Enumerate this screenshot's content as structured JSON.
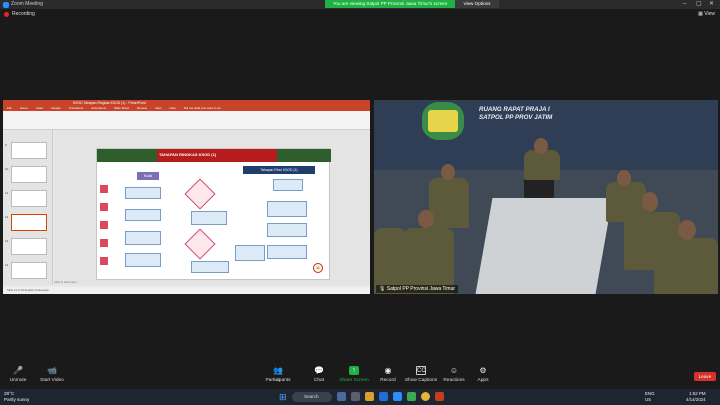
{
  "titlebar": {
    "app_title": "Zoom Meeting",
    "share_banner": "You are viewing Satpol PP Provinsi Jawa Timur's screen",
    "view_options": "View Options"
  },
  "recording": {
    "label": "Recording"
  },
  "view_button": "View",
  "powerpoint": {
    "title": "KSOD Tahapan Ringkas KSOD (1) - PowerPoint",
    "tabs": [
      "File",
      "Home",
      "Insert",
      "Design",
      "Transitions",
      "Animations",
      "Slide Show",
      "Review",
      "View",
      "Help",
      "Tell me what you want to do"
    ],
    "thumbnail_numbers": [
      "9",
      "10",
      "11",
      "12",
      "13",
      "14",
      "15"
    ],
    "slide": {
      "title": "TAHAPAN RINGKAS KSOD (1)",
      "subhead": "Tahapan Rinci KSOD (1)",
      "start": "Mulai",
      "page_number": "11"
    },
    "notes": "Click to add notes",
    "status": "Slide 11 of 29   English (Indonesia)"
  },
  "video": {
    "banner_line1": "RUANG RAPAT PRAJA I",
    "banner_line2": "SATPOL PP PROV JATIM",
    "participant_label": "Satpol PP Provinsi Jawa Timur"
  },
  "toolbar": {
    "items": [
      {
        "label": "Unmute",
        "icon": "mic-muted-icon"
      },
      {
        "label": "Start Video",
        "icon": "camera-off-icon"
      },
      {
        "label": "Participants",
        "icon": "participants-icon",
        "count": "41"
      },
      {
        "label": "Chat",
        "icon": "chat-icon"
      },
      {
        "label": "Share Screen",
        "icon": "share-screen-icon"
      },
      {
        "label": "Record",
        "icon": "record-icon"
      },
      {
        "label": "Show Captions",
        "icon": "captions-icon"
      },
      {
        "label": "Reactions",
        "icon": "reactions-icon"
      },
      {
        "label": "Apps",
        "icon": "apps-icon"
      }
    ],
    "leave": "Leave",
    "share_color": "#1fb141",
    "leave_color": "#d6332c"
  },
  "taskbar": {
    "weather_temp": "29°C",
    "weather_desc": "Partly sunny",
    "search": "Search",
    "lang": "ENG",
    "region": "US",
    "time": "1:52 PM",
    "date": "4/14/2024"
  }
}
